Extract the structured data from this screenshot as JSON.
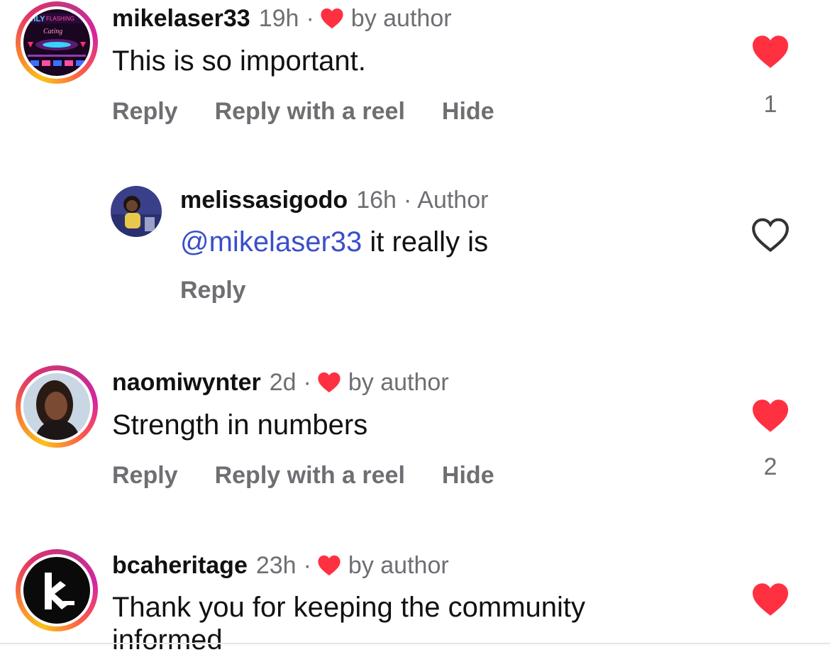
{
  "colors": {
    "heart_red": "#ff3040",
    "muted": "#6e6e73",
    "mention_blue": "#3a4fc9"
  },
  "comments": [
    {
      "username": "mikelaser33",
      "time": "19h",
      "separator": "·",
      "liked_by_author_label": "by author",
      "text": "This is so important.",
      "actions": [
        "Reply",
        "Reply with a reel",
        "Hide"
      ],
      "liked": true,
      "like_count": "1",
      "avatar_icon": "event-flyer-avatar"
    },
    {
      "username": "melissasigodo",
      "time": "16h",
      "separator": "·",
      "author_label": "Author",
      "mention": "@mikelaser33",
      "text": " it really is",
      "actions": [
        "Reply"
      ],
      "liked": false,
      "avatar_icon": "person-portrait-avatar"
    },
    {
      "username": "naomiwynter",
      "time": "2d",
      "separator": "·",
      "liked_by_author_label": "by author",
      "text": "Strength in numbers",
      "actions": [
        "Reply",
        "Reply with a reel",
        "Hide"
      ],
      "liked": true,
      "like_count": "2",
      "avatar_icon": "person-portrait-avatar"
    },
    {
      "username": "bcaheritage",
      "time": "23h",
      "separator": "·",
      "liked_by_author_label": "by author",
      "text_line1": "Thank you for keeping the community",
      "text_line2": "informed",
      "liked": true,
      "avatar_icon": "bca-logo-avatar"
    }
  ]
}
